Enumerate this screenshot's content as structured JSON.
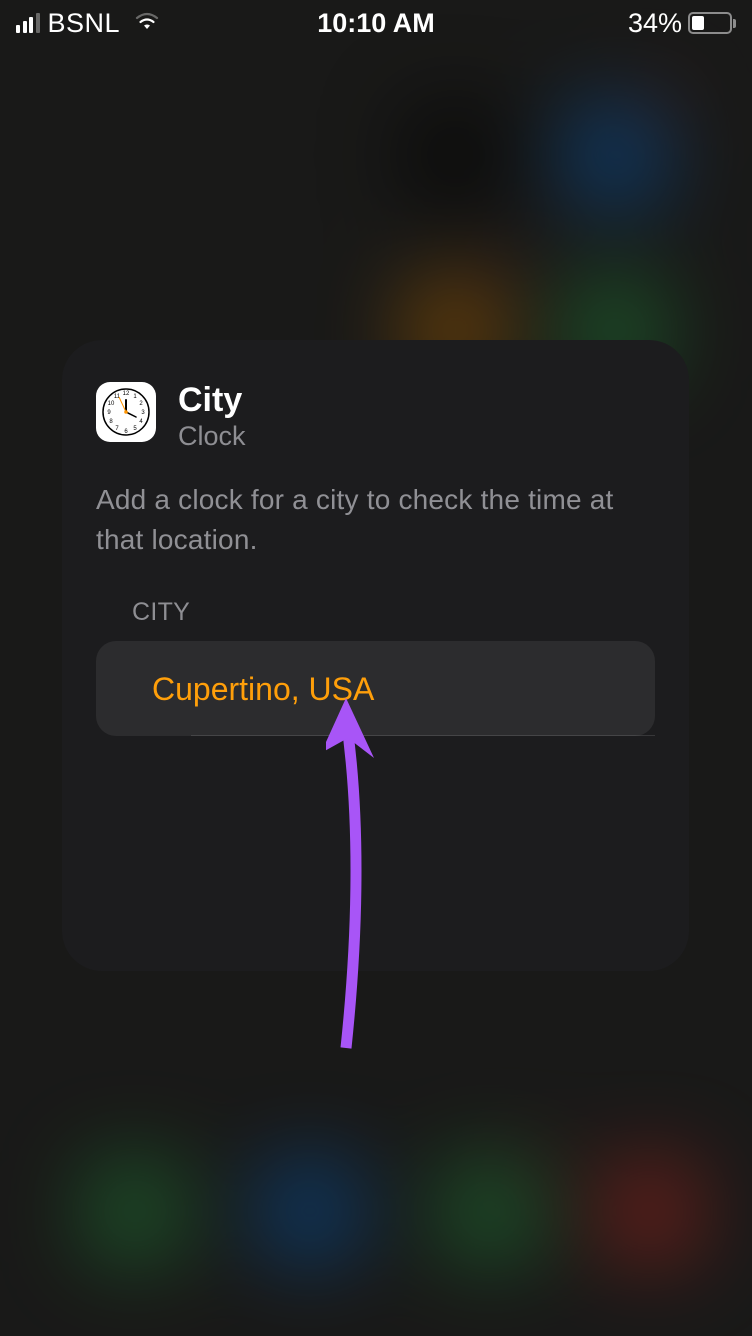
{
  "status_bar": {
    "carrier": "BSNL",
    "time": "10:10 AM",
    "battery_percent": "34%"
  },
  "modal": {
    "title": "City",
    "subtitle": "Clock",
    "description": "Add a clock for a city to check the time at that location.",
    "section_label": "CITY",
    "city_value": "Cupertino, USA"
  }
}
